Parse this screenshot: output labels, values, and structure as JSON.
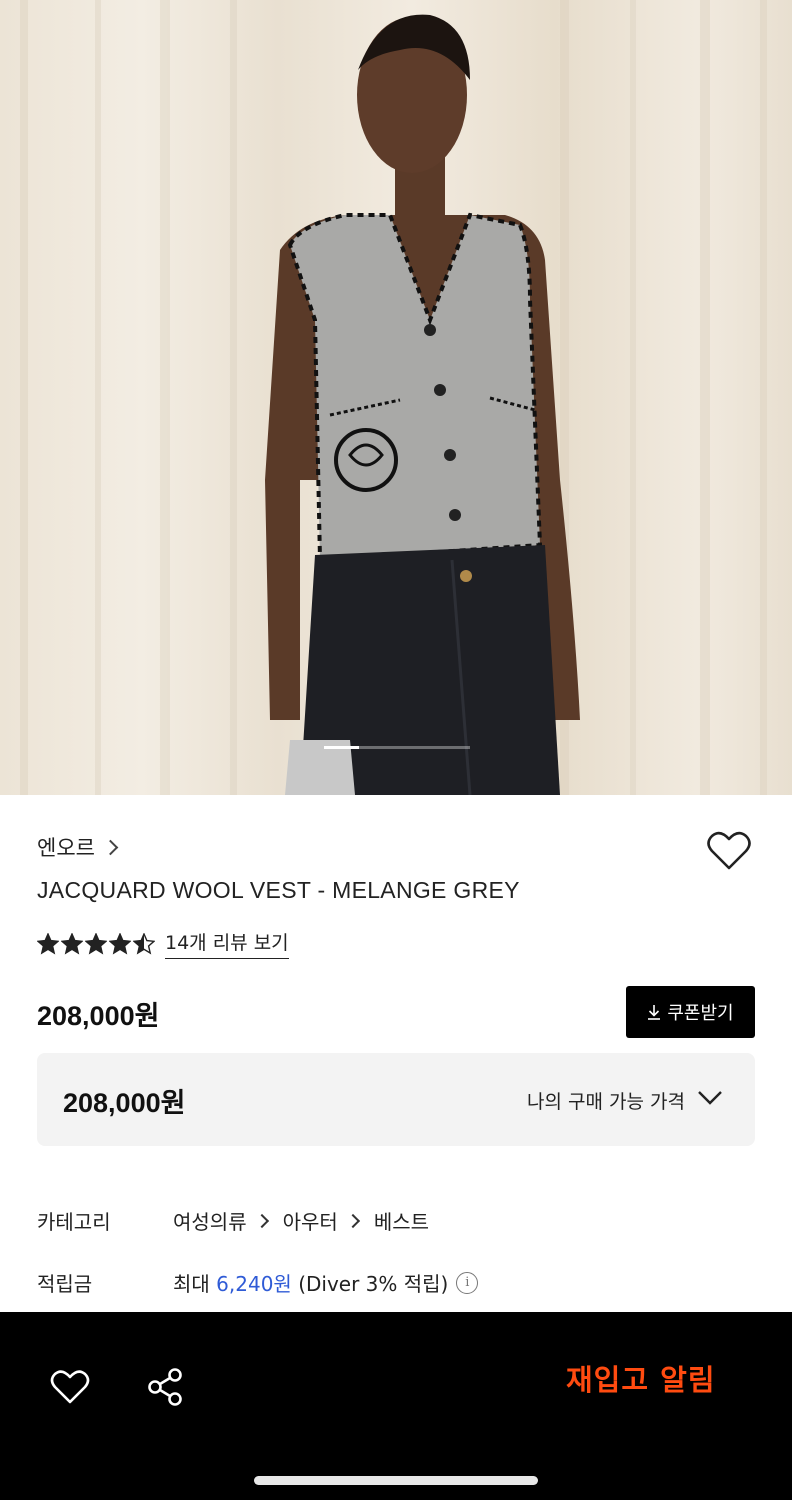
{
  "hero": {
    "image_alt": "Model wearing grey jacquard wool vest with black blanket stitch trim",
    "slide_progress": 0.24
  },
  "product": {
    "brand": "엔오르",
    "title": "JACQUARD WOOL VEST - MELANGE GREY",
    "rating": 4.5,
    "reviews_link": "14개 리뷰 보기",
    "price": "208,000원",
    "coupon_label": "쿠폰받기",
    "my_price_value": "208,000원",
    "my_price_label": "나의 구매 가능 가격"
  },
  "info": {
    "category_key": "카테고리",
    "category_path": [
      "여성의류",
      "아우터",
      "베스트"
    ],
    "points_key": "적립금",
    "points_prefix": "최대",
    "points_value": "6,240원",
    "points_suffix": "(Diver 3% 적립)"
  },
  "bottom_bar": {
    "restock_label": "재입고 알림"
  },
  "colors": {
    "accent_orange": "#ff4b10",
    "link_blue": "#2f5bd6",
    "bar_bg": "#000000"
  },
  "icons": [
    "chevron-right-icon",
    "heart-icon",
    "star-icon",
    "download-icon",
    "chevron-down-icon",
    "info-icon",
    "share-icon"
  ]
}
